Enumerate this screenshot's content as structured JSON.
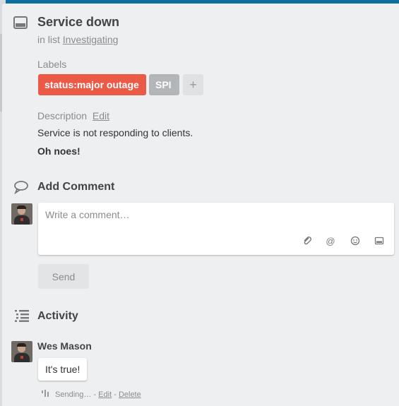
{
  "card": {
    "title": "Service down",
    "in_list_prefix": "in list",
    "list_name": "Investigating"
  },
  "labels": {
    "heading": "Labels",
    "items": [
      {
        "text": "status:major outage",
        "color": "#eb5a46"
      },
      {
        "text": "SPI",
        "color": "#b3b6b9"
      }
    ],
    "add_symbol": "+"
  },
  "description": {
    "heading": "Description",
    "edit_link": "Edit",
    "text": "Service is not responding to clients.",
    "emphasis": "Oh noes!"
  },
  "add_comment": {
    "heading": "Add Comment",
    "placeholder": "Write a comment…",
    "send_label": "Send",
    "toolbar_icons": [
      "attachment-icon",
      "mention-icon",
      "emoji-icon",
      "card-icon"
    ]
  },
  "activity": {
    "heading": "Activity",
    "entries": [
      {
        "author": "Wes Mason",
        "comment": "It's true!",
        "status": "Sending…",
        "sep1": "-",
        "edit_link": "Edit",
        "sep2": "-",
        "delete_link": "Delete"
      }
    ]
  }
}
